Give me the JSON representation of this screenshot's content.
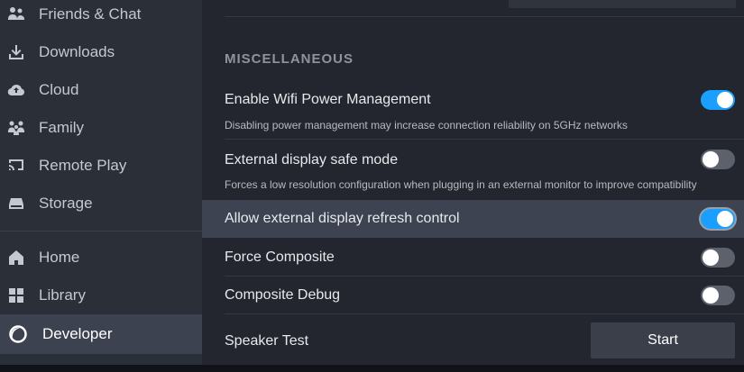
{
  "sidebar": {
    "items": [
      {
        "label": "Friends & Chat",
        "icon": "friends-icon"
      },
      {
        "label": "Downloads",
        "icon": "download-icon"
      },
      {
        "label": "Cloud",
        "icon": "cloud-icon"
      },
      {
        "label": "Family",
        "icon": "family-icon"
      },
      {
        "label": "Remote Play",
        "icon": "remote-play-icon"
      },
      {
        "label": "Storage",
        "icon": "storage-icon"
      },
      {
        "label": "Home",
        "icon": "home-icon"
      },
      {
        "label": "Library",
        "icon": "library-icon"
      },
      {
        "label": "Developer",
        "icon": "developer-icon",
        "active": true
      }
    ]
  },
  "main": {
    "section_title": "MISCELLANEOUS",
    "settings": [
      {
        "title": "Enable Wifi Power Management",
        "description": "Disabling power management may increase connection reliability on 5GHz networks",
        "toggle": "on"
      },
      {
        "title": "External display safe mode",
        "description": "Forces a low resolution configuration when plugging in an external monitor to improve compatibility",
        "toggle": "off"
      },
      {
        "title": "Allow external display refresh control",
        "toggle": "on",
        "highlighted": true
      },
      {
        "title": "Force Composite",
        "toggle": "off"
      },
      {
        "title": "Composite Debug",
        "toggle": "off"
      },
      {
        "title": "Speaker Test",
        "button": "Start"
      }
    ]
  },
  "colors": {
    "accent": "#1a9fff",
    "sidebar_bg": "#2b2f38",
    "content_bg": "#23262e",
    "highlight_bg": "#3d4350"
  }
}
